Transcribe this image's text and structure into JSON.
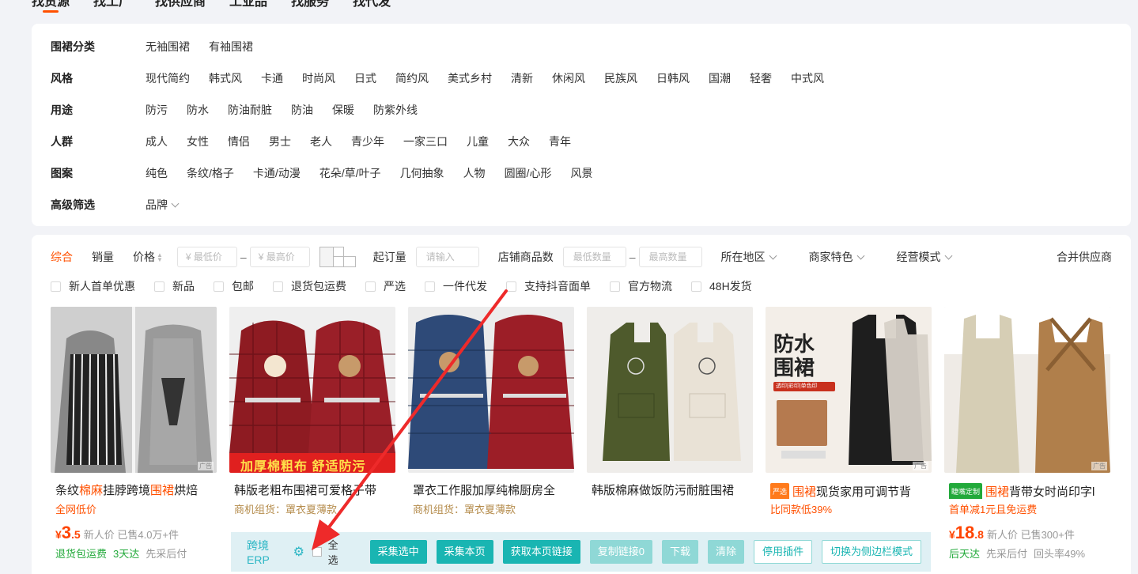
{
  "top_tabs": [
    "找货源",
    "找工厂",
    "找供应商",
    "工业品",
    "找服务",
    "找代发"
  ],
  "filters": [
    {
      "label": "围裙分类",
      "options": [
        "无袖围裙",
        "有袖围裙"
      ]
    },
    {
      "label": "风格",
      "options": [
        "现代简约",
        "韩式风",
        "卡通",
        "时尚风",
        "日式",
        "简约风",
        "美式乡村",
        "清新",
        "休闲风",
        "民族风",
        "日韩风",
        "国潮",
        "轻奢",
        "中式风"
      ]
    },
    {
      "label": "用途",
      "options": [
        "防污",
        "防水",
        "防油耐脏",
        "防油",
        "保暖",
        "防紫外线"
      ]
    },
    {
      "label": "人群",
      "options": [
        "成人",
        "女性",
        "情侣",
        "男士",
        "老人",
        "青少年",
        "一家三口",
        "儿童",
        "大众",
        "青年"
      ]
    },
    {
      "label": "图案",
      "options": [
        "纯色",
        "条纹/格子",
        "卡通/动漫",
        "花朵/草/叶子",
        "几何抽象",
        "人物",
        "圆圈/心形",
        "风景"
      ]
    },
    {
      "label": "高级筛选",
      "options": [
        "品牌"
      ]
    }
  ],
  "sortbar": {
    "sorts": [
      "综合",
      "销量",
      "价格"
    ],
    "price_min_placeholder": "¥ 最低价",
    "price_max_placeholder": "¥ 最高价",
    "moq_label": "起订量",
    "moq_placeholder": "请输入",
    "shop_count_label": "店铺商品数",
    "shop_min_placeholder": "最低数量",
    "shop_max_placeholder": "最高数量",
    "region": "所在地区",
    "merchant": "商家特色",
    "mode": "经营模式",
    "merge": "合并供应商"
  },
  "checks": [
    "新人首单优惠",
    "新品",
    "包邮",
    "退货包运费",
    "严选",
    "一件代发",
    "支持抖音面单",
    "官方物流",
    "48H发货"
  ],
  "products": [
    {
      "title_pre": "条纹",
      "title_hl1": "棉麻",
      "title_mid": "挂脖跨境",
      "title_hl2": "围裙",
      "title_post": "烘焙",
      "sub": "全网低价",
      "price_int": "3",
      "price_dec": ".5",
      "meta": "新人价 已售4.0万+件",
      "tags_green": [
        "退货包运费",
        "3天达"
      ],
      "tags_gray": [
        "先采后付"
      ]
    },
    {
      "title_pre": "韩版老粗布围裙可爱格子带",
      "sub": "商机组货：罩衣夏薄款",
      "banner": "加厚棉粗布  舒适防污"
    },
    {
      "title_pre": "罩衣工作服加厚纯棉厨房全",
      "sub": "商机组货：罩衣夏薄款"
    },
    {
      "title_pre": "韩版棉麻做饭防污耐脏围裙"
    },
    {
      "badge": "严选",
      "title_hl1": "围裙",
      "title_post": "现货家用可调节背",
      "sub": "比同款低39%",
      "img_text": "防水\n围裙",
      "img_sub": "透印|彩印|单色印"
    },
    {
      "badge": "睫嘴定制",
      "title_hl1": "围裙",
      "title_post": "背带女时尚印字l",
      "sub": "首单减1元且免运费",
      "price_int": "18",
      "price_dec": ".8",
      "meta": "新人价 已售300+件",
      "tags_green": [
        "后天达"
      ],
      "tags_gray": [
        "先采后付",
        "回头率49%"
      ]
    }
  ],
  "ad_label": "广告",
  "erp": {
    "title": "跨境ERP",
    "select_all": "全选",
    "buttons": [
      "采集选中",
      "采集本页",
      "获取本页链接",
      "复制链接0",
      "下载",
      "清除",
      "停用插件",
      "切换为侧边栏模式"
    ]
  },
  "colors": {
    "accent": "#ff5000",
    "erp": "#19b5b2",
    "arrow": "#ee2a2a"
  }
}
